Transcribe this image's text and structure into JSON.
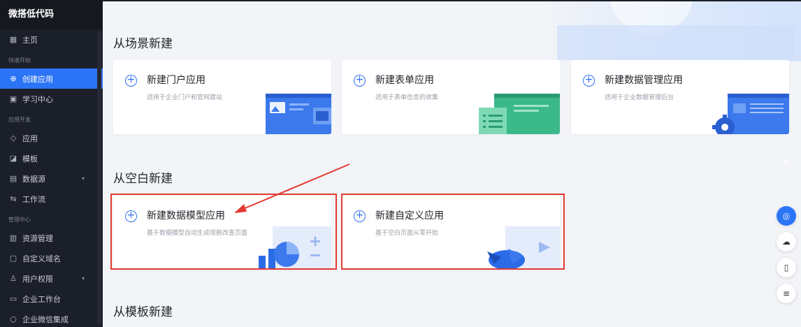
{
  "sidebar": {
    "brand": "微搭低代码",
    "home": "主页",
    "groups": {
      "quick": "快速开始",
      "dev": "应用开发",
      "manage": "管理中心"
    },
    "items": {
      "create_app": "创建应用",
      "learn": "学习中心",
      "apps": "应用",
      "templates": "模板",
      "datasource": "数据源",
      "workflow": "工作流",
      "resources": "资源管理",
      "domain": "自定义域名",
      "permissions": "用户权限",
      "workbench": "企业工作台",
      "wecom": "企业微信集成"
    },
    "icons": {
      "home": "grid-icon",
      "create_app": "plus-circle-icon",
      "learn": "book-icon",
      "apps": "layers-icon",
      "templates": "template-icon",
      "datasource": "database-icon",
      "workflow": "flow-icon",
      "resources": "resource-icon",
      "domain": "domain-icon",
      "permissions": "user-icon",
      "workbench": "workbench-icon",
      "wecom": "wecom-icon"
    }
  },
  "main": {
    "scene_title": "从场景新建",
    "blank_title": "从空白新建",
    "template_title": "从模板新建",
    "scene_cards": [
      {
        "title": "新建门户应用",
        "desc": "适用于企业门户和官网建站"
      },
      {
        "title": "新建表单应用",
        "desc": "适用于表单信息的收集"
      },
      {
        "title": "新建数据管理应用",
        "desc": "适用于企业数据管理后台"
      }
    ],
    "blank_cards": [
      {
        "title": "新建数据模型应用",
        "desc": "基于数据模型自动生成增删改查页面"
      },
      {
        "title": "新建自定义应用",
        "desc": "基于空白页面从零开始"
      }
    ]
  },
  "rail": {
    "icons": [
      "headset-icon",
      "cloud-icon",
      "book-open-icon",
      "list-icon"
    ]
  },
  "colors": {
    "accent": "#2b74f6",
    "sidebar_bg": "#1b1f29",
    "highlight": "#e23a33"
  }
}
